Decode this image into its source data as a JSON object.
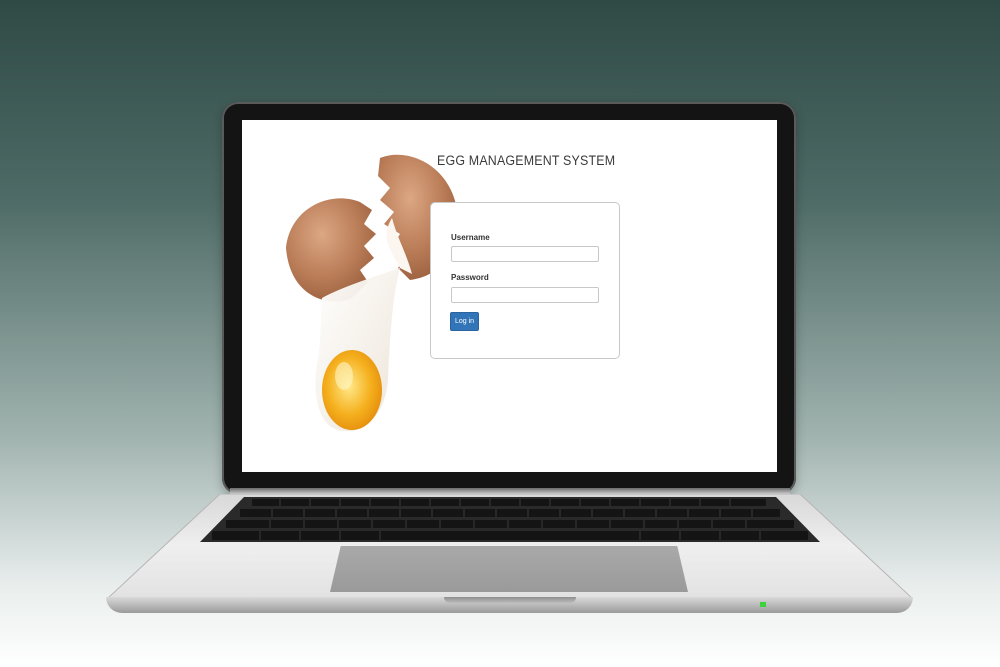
{
  "app": {
    "title": "EGG MANAGEMENT SYSTEM"
  },
  "login_form": {
    "username_label": "Username",
    "username_value": "",
    "password_label": "Password",
    "password_value": "",
    "submit_label": "Log in"
  },
  "colors": {
    "button": "#3174b8",
    "background_top": "#2f4a45",
    "screen_bg": "#ffffff"
  },
  "illustration": "cracked-egg-image"
}
